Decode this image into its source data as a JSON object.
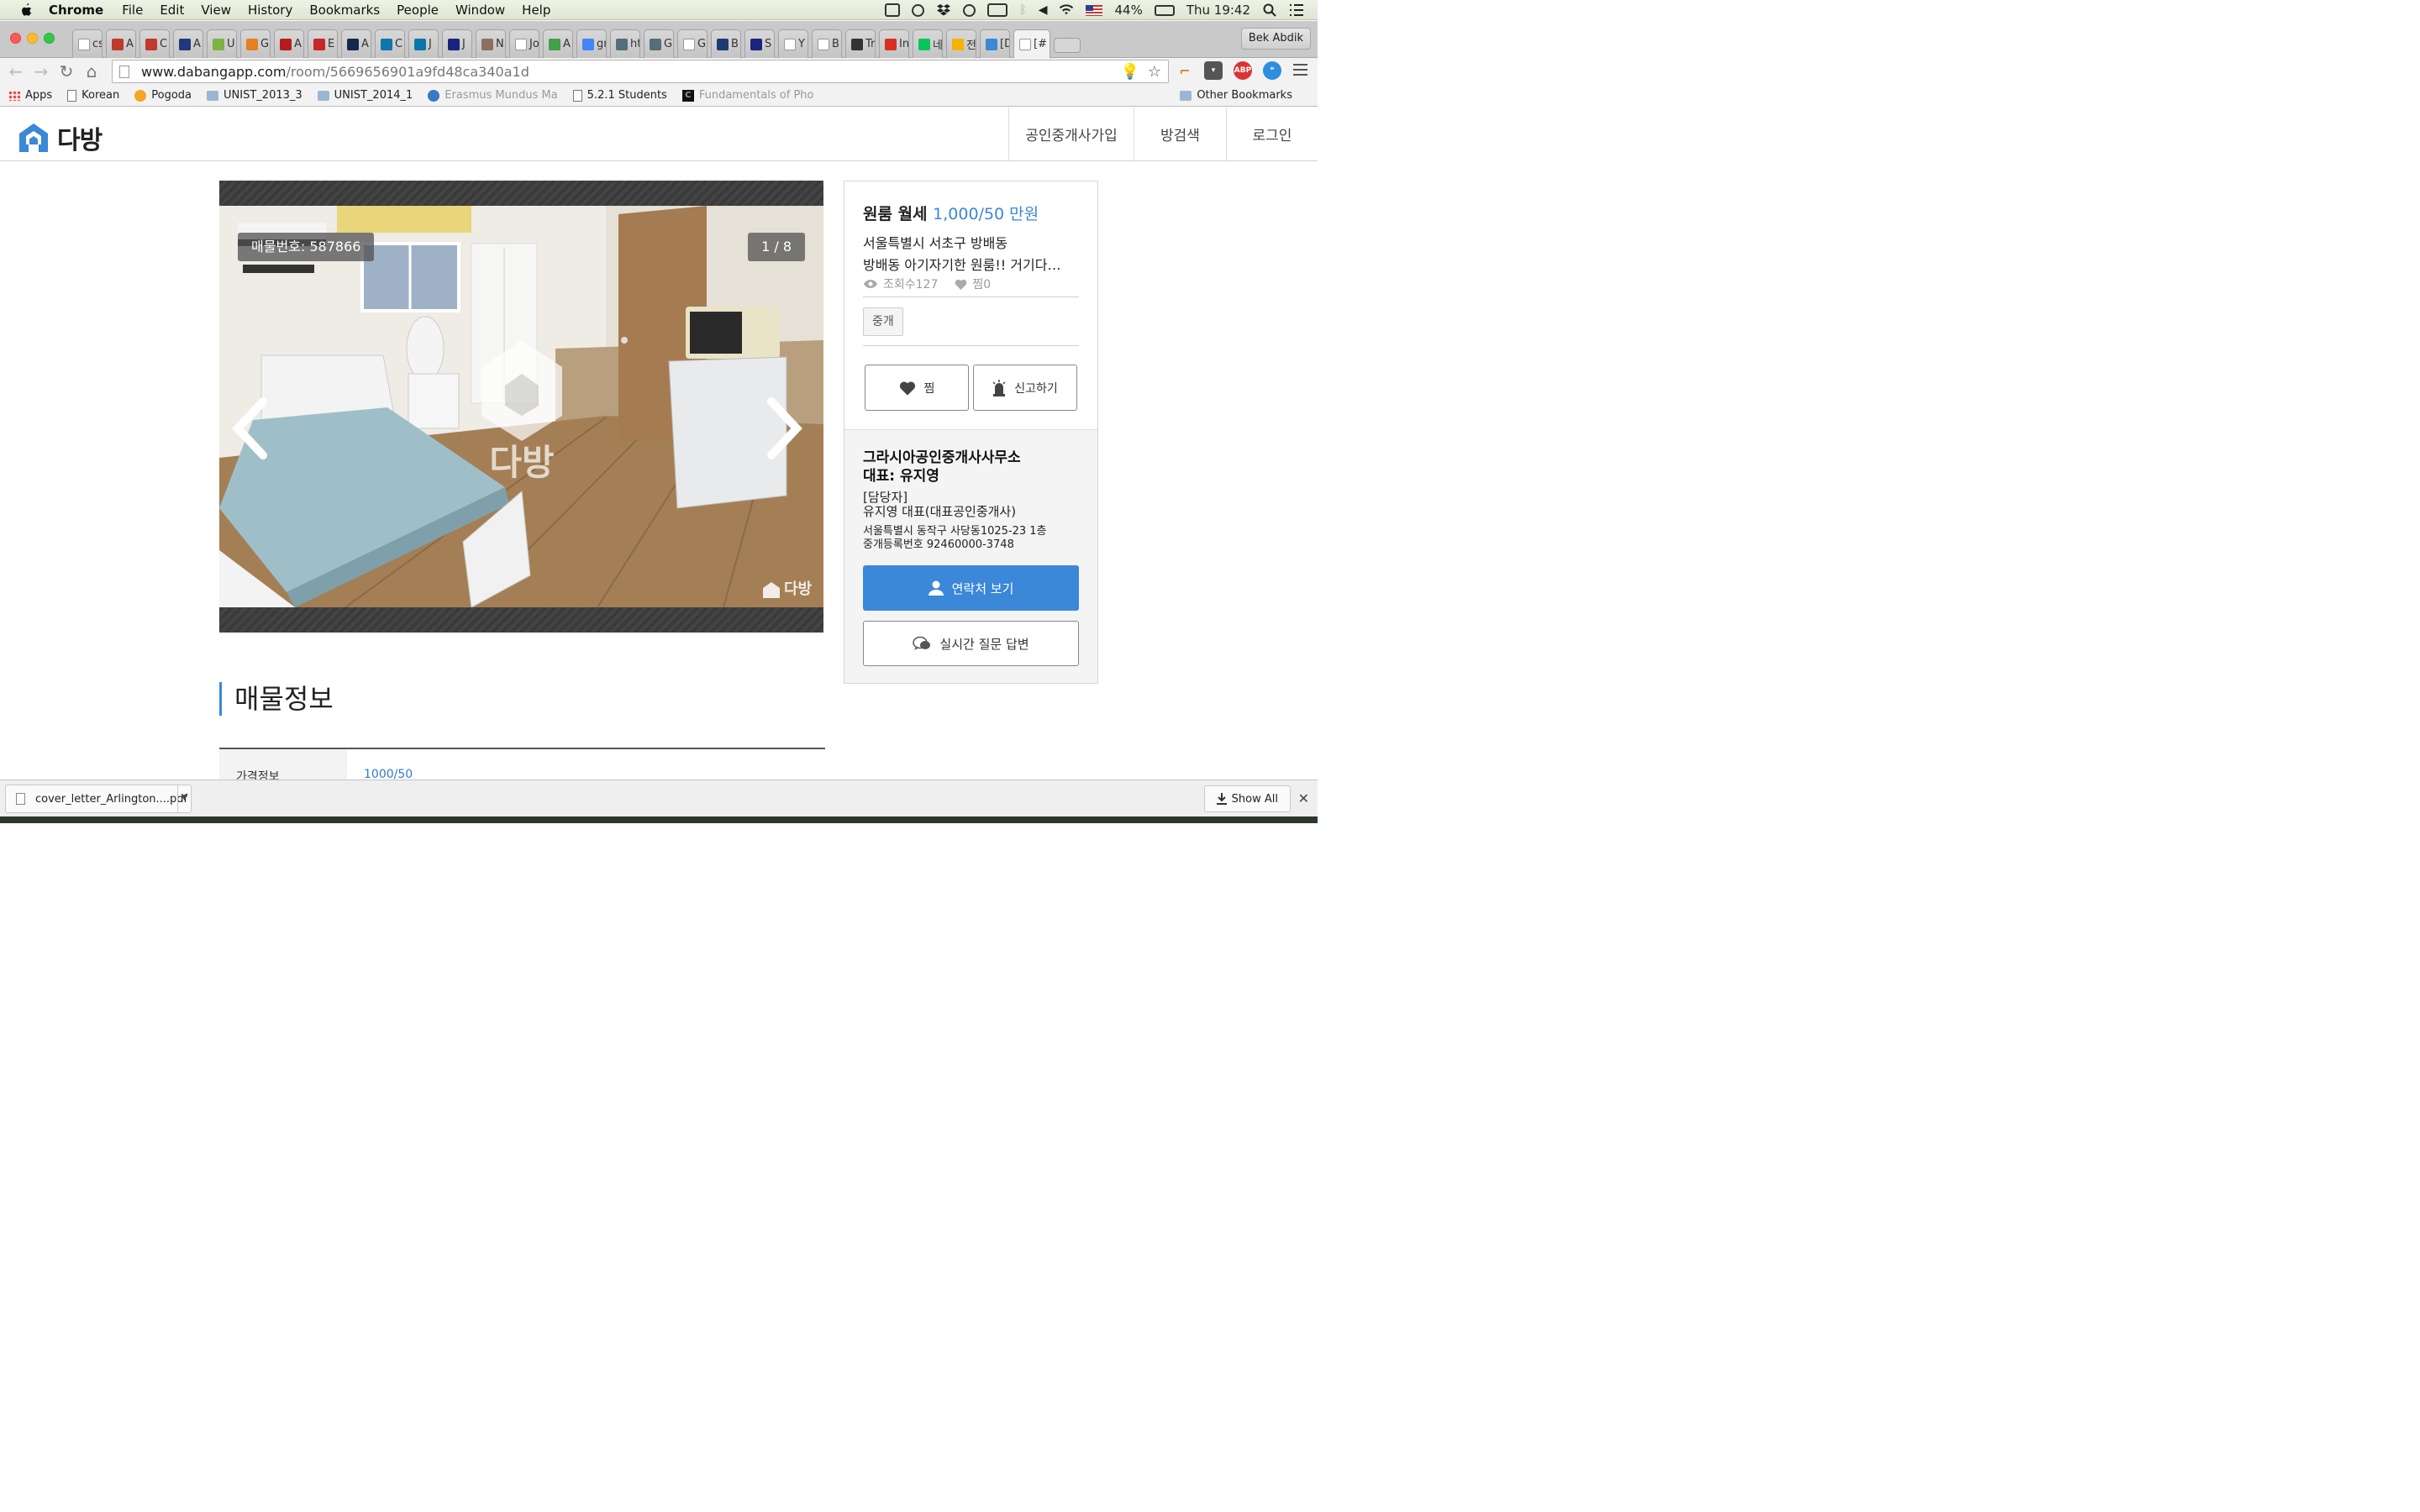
{
  "menubar": {
    "app_name": "Chrome",
    "items": [
      "File",
      "Edit",
      "View",
      "History",
      "Bookmarks",
      "People",
      "Window",
      "Help"
    ],
    "battery": "44%",
    "clock": "Thu 19:42",
    "icons": [
      "screen-mirror-icon",
      "cloud-icon",
      "dropbox-icon",
      "sync-icon",
      "memory-icon",
      "bluetooth-icon",
      "volume-icon",
      "wifi-icon",
      "us-flag-icon",
      "battery-icon",
      "spotlight-icon",
      "notification-list-icon"
    ]
  },
  "tabs": [
    {
      "label": "cs",
      "color": "#ffffff"
    },
    {
      "label": "A",
      "color": "#c0392b"
    },
    {
      "label": "C",
      "color": "#c0392b"
    },
    {
      "label": "A",
      "color": "#1f3a7a"
    },
    {
      "label": "U",
      "color": "#7cb342"
    },
    {
      "label": "G",
      "color": "#e67e22"
    },
    {
      "label": "A",
      "color": "#b71c1c"
    },
    {
      "label": "E",
      "color": "#c62828"
    },
    {
      "label": "A",
      "color": "#13294b"
    },
    {
      "label": "C",
      "color": "#0e76a8"
    },
    {
      "label": "J",
      "color": "#0e76a8"
    },
    {
      "label": "J",
      "color": "#1a237e"
    },
    {
      "label": "N",
      "color": "#8d6e63"
    },
    {
      "label": "Jo",
      "color": "#ffffff"
    },
    {
      "label": "A",
      "color": "#43a047"
    },
    {
      "label": "gr",
      "color": "#4285f4"
    },
    {
      "label": "ht",
      "color": "#546e7a"
    },
    {
      "label": "G",
      "color": "#546e7a"
    },
    {
      "label": "G",
      "color": "#ffffff"
    },
    {
      "label": "B",
      "color": "#1e3a6e"
    },
    {
      "label": "S",
      "color": "#1a237e"
    },
    {
      "label": "Y",
      "color": "#ffffff"
    },
    {
      "label": "B",
      "color": "#ffffff"
    },
    {
      "label": "Tr",
      "color": "#333333"
    },
    {
      "label": "In",
      "color": "#d93025"
    },
    {
      "label": "네",
      "color": "#03c75a"
    },
    {
      "label": "전",
      "color": "#f4b400"
    },
    {
      "label": "[D",
      "color": "#3b87d8"
    },
    {
      "label": "[#",
      "color": "#ffffff",
      "active": true
    }
  ],
  "profile_name": "Bek Abdik",
  "address_bar": {
    "host": "www.dabangapp.com",
    "path": "/room/5669656901a9fd48ca340a1d"
  },
  "extensions": [
    "cursor-icon",
    "pocket-icon",
    "adblock-icon",
    "chat-extension-icon"
  ],
  "extension_labels": {
    "adblock": "ABP"
  },
  "bookmarks": [
    {
      "label": "Apps",
      "icon": "apps-grid-icon"
    },
    {
      "label": "Korean",
      "icon": "page-icon"
    },
    {
      "label": "Pogoda",
      "icon": "sun-icon"
    },
    {
      "label": "UNIST_2013_3",
      "icon": "folder-icon"
    },
    {
      "label": "UNIST_2014_1",
      "icon": "folder-icon"
    },
    {
      "label": "Erasmus Mundus Ma",
      "icon": "plane-icon"
    },
    {
      "label": "5.2.1 Students",
      "icon": "page-icon"
    },
    {
      "label": "Fundamentals of Pho",
      "icon": "c-logo-icon"
    }
  ],
  "other_bookmarks": "Other Bookmarks",
  "site": {
    "logo_text": "다방",
    "nav": [
      "공인중개사가입",
      "방검색",
      "로그인"
    ]
  },
  "gallery": {
    "listing_id": "매물번호: 587866",
    "counter": "1 / 8",
    "watermark": "다방"
  },
  "listing": {
    "type": "원룸 월세",
    "price": "1,000/50 만원",
    "address": "서울특별시 서초구 방배동",
    "description": "방배동 아기자기한 원룸!! 거기다…",
    "views": "조회수127",
    "likes": "찜0",
    "tag": "중개",
    "like_button": "찜",
    "report_button": "신고하기"
  },
  "agency": {
    "name": "그라시아공인중개사사무소",
    "representative": "대표: 유지영",
    "contact_label": "[담당자]",
    "contact_person": "유지영 대표(대표공인중개사)",
    "address": "서울특별시 동작구 사당동1025-23 1층",
    "registration": "중개등록번호 92460000-3748",
    "contact_button": "연락처 보기",
    "qa_button": "실시간 질문 답변"
  },
  "section": {
    "title": "매물정보",
    "rows": [
      {
        "label": "가격정보",
        "value": "1000/50"
      }
    ]
  },
  "downloads": {
    "file_name": "cover_letter_Arlington....pdf",
    "show_all": "Show All"
  },
  "colors": {
    "accent": "#3b87d8",
    "tab_bar": "#c9c9c9"
  }
}
